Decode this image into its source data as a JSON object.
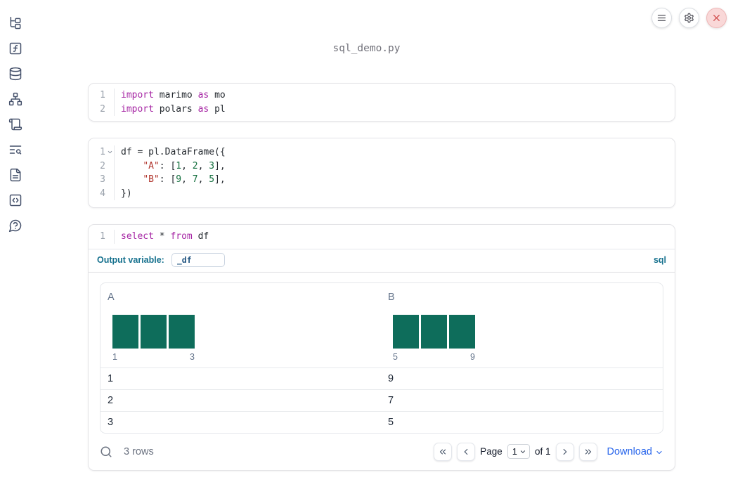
{
  "title": "sql_demo.py",
  "colors": {
    "bar_teal": "#0E6D5B",
    "sql_accent": "#16718E",
    "download_blue": "#2563EB",
    "keyword": "#A626A4",
    "string": "#B0342C",
    "number": "#136F3E",
    "close_red": "#D04A4A"
  },
  "topbar": {
    "buttons": [
      {
        "icon": "menu-icon"
      },
      {
        "icon": "gear-icon"
      },
      {
        "icon": "close-icon"
      }
    ]
  },
  "sidebar": {
    "items": [
      {
        "icon": "file-tree-icon"
      },
      {
        "icon": "function-square-icon"
      },
      {
        "icon": "database-icon"
      },
      {
        "icon": "dependency-graph-icon"
      },
      {
        "icon": "scroll-icon"
      },
      {
        "icon": "logs-search-icon"
      },
      {
        "icon": "documentation-icon"
      },
      {
        "icon": "snippets-icon"
      },
      {
        "icon": "help-icon"
      }
    ]
  },
  "cells": [
    {
      "kind": "code",
      "lines": [
        {
          "n": "1",
          "fold": false,
          "tokens": [
            [
              "kw",
              "import"
            ],
            [
              "pl",
              " marimo "
            ],
            [
              "kw",
              "as"
            ],
            [
              "pl",
              " mo"
            ]
          ]
        },
        {
          "n": "2",
          "fold": false,
          "tokens": [
            [
              "kw",
              "import"
            ],
            [
              "pl",
              " polars "
            ],
            [
              "kw",
              "as"
            ],
            [
              "pl",
              " pl"
            ]
          ]
        }
      ]
    },
    {
      "kind": "code",
      "lines": [
        {
          "n": "1",
          "fold": true,
          "tokens": [
            [
              "pl",
              "df = pl.DataFrame({"
            ]
          ]
        },
        {
          "n": "2",
          "fold": false,
          "tokens": [
            [
              "pl",
              "    "
            ],
            [
              "str",
              "\"A\""
            ],
            [
              "pl",
              ": ["
            ],
            [
              "num",
              "1"
            ],
            [
              "pl",
              ", "
            ],
            [
              "num",
              "2"
            ],
            [
              "pl",
              ", "
            ],
            [
              "num",
              "3"
            ],
            [
              "pl",
              "],"
            ]
          ]
        },
        {
          "n": "3",
          "fold": false,
          "tokens": [
            [
              "pl",
              "    "
            ],
            [
              "str",
              "\"B\""
            ],
            [
              "pl",
              ": ["
            ],
            [
              "num",
              "9"
            ],
            [
              "pl",
              ", "
            ],
            [
              "num",
              "7"
            ],
            [
              "pl",
              ", "
            ],
            [
              "num",
              "5"
            ],
            [
              "pl",
              "],"
            ]
          ]
        },
        {
          "n": "4",
          "fold": false,
          "tokens": [
            [
              "pl",
              "})"
            ]
          ]
        }
      ]
    },
    {
      "kind": "sql",
      "lines": [
        {
          "n": "1",
          "fold": false,
          "tokens": [
            [
              "kw",
              "select"
            ],
            [
              "pl",
              " * "
            ],
            [
              "kw",
              "from"
            ],
            [
              "pl",
              " df"
            ]
          ]
        }
      ],
      "output_variable_label": "Output variable:",
      "output_variable_value": "_df",
      "language_badge": "sql"
    }
  ],
  "table": {
    "columns": [
      {
        "name": "A",
        "hist": {
          "type": "bar",
          "bars": [
            1,
            1,
            1
          ],
          "min_label": "1",
          "max_label": "3"
        }
      },
      {
        "name": "B",
        "hist": {
          "type": "bar",
          "bars": [
            1,
            1,
            1
          ],
          "min_label": "5",
          "max_label": "9"
        }
      }
    ],
    "rows": [
      [
        "1",
        "9"
      ],
      [
        "2",
        "7"
      ],
      [
        "3",
        "5"
      ]
    ],
    "footer": {
      "row_count": "3 rows",
      "page_label": "Page",
      "page_value": "1",
      "of_label": "of 1",
      "download_label": "Download"
    }
  }
}
